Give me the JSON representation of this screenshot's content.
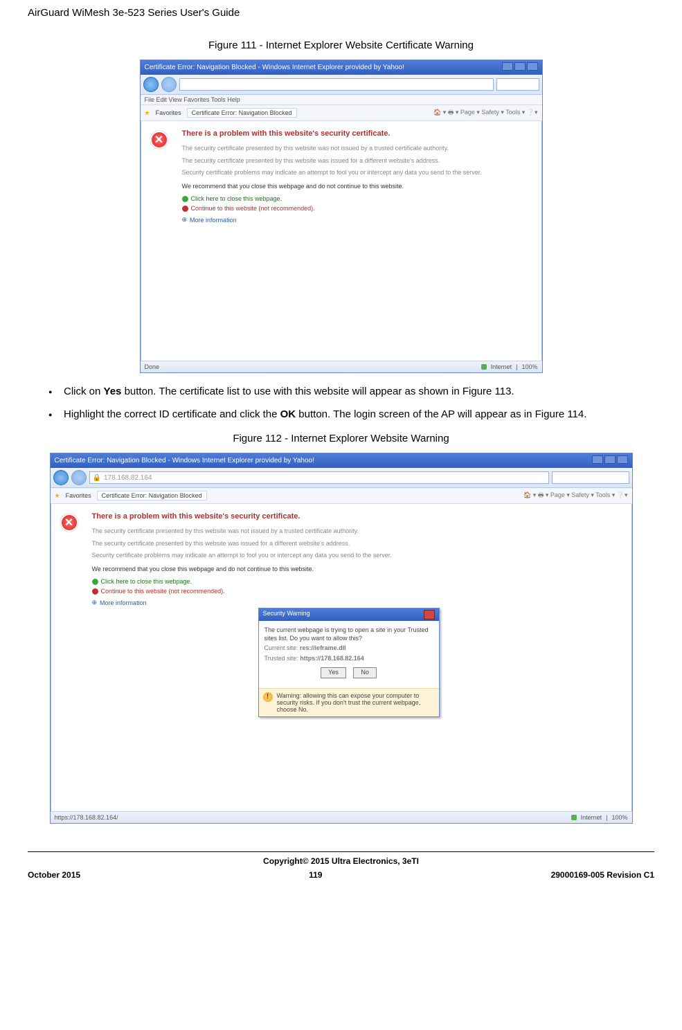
{
  "doc": {
    "header": "AirGuard WiMesh 3e-523 Series User's Guide",
    "fig111_caption": "Figure 111 - Internet Explorer Website Certificate Warning",
    "bullet1_pre": "Click on ",
    "bullet1_bold": "Yes",
    "bullet1_post": " button. The certificate list to use with this website will appear as shown in Figure 113.",
    "bullet2_pre": "Highlight the correct ID certificate and click the ",
    "bullet2_bold": "OK",
    "bullet2_post": " button. The login screen of the AP will appear as in Figure 114.",
    "fig112_caption": "Figure 112 - Internet Explorer Website Warning",
    "footer_copyright": "Copyright© 2015 Ultra Electronics, 3eTI",
    "footer_left": "October 2015",
    "footer_center": "119",
    "footer_right": "29000169-005 Revision C1"
  },
  "ie1": {
    "title": "Certificate Error: Navigation Blocked - Windows Internet Explorer provided by Yahoo!",
    "menu": "File   Edit   View   Favorites   Tools   Help",
    "favorites": "Favorites",
    "tab": "Certificate Error: Navigation Blocked",
    "heading": "There is a problem with this website's security certificate.",
    "p1": "The security certificate presented by this website was not issued by a trusted certificate authority.",
    "p2": "The security certificate presented by this website was issued for a different website's address.",
    "p3": "Security certificate problems may indicate an attempt to fool you or intercept any data you send to the server.",
    "rec": "We recommend that you close this webpage and do not continue to this website.",
    "link_close": "Click here to close this webpage.",
    "link_cont": "Continue to this website (not recommended).",
    "link_more": "More information",
    "status_done": "Done",
    "status_zone": "Internet",
    "status_zoom": "100%"
  },
  "ie2": {
    "title": "Certificate Error: Navigation Blocked - Windows Internet Explorer provided by Yahoo!",
    "addr": "178.168.82.164",
    "favorites": "Favorites",
    "tab": "Certificate Error: Navigation Blocked",
    "heading": "There is a problem with this website's security certificate.",
    "p1": "The security certificate presented by this website was not issued by a trusted certificate authority.",
    "p2": "The security certificate presented by this website was issued for a different website's address.",
    "p3": "Security certificate problems may indicate an attempt to fool you or intercept any data you send to the server.",
    "rec": "We recommend that you close this webpage and do not continue to this website.",
    "link_close": "Click here to close this webpage.",
    "link_cont": "Continue to this website (not recommended).",
    "link_more": "More information",
    "status_left": "https://178.168.82.164/",
    "status_zone": "Internet",
    "status_zoom": "100%"
  },
  "dialog": {
    "title": "Security Warning",
    "msg": "The current webpage is trying to open a site in your Trusted sites list. Do you want to allow this?",
    "row1_label": "Current site:",
    "row1_val": "res://ieframe.dll",
    "row2_label": "Trusted site:",
    "row2_val": "https://178.168.82.164",
    "yes": "Yes",
    "no": "No",
    "warn": "Warning: allowing this can expose your computer to security risks. If you don't trust the current webpage, choose No."
  }
}
